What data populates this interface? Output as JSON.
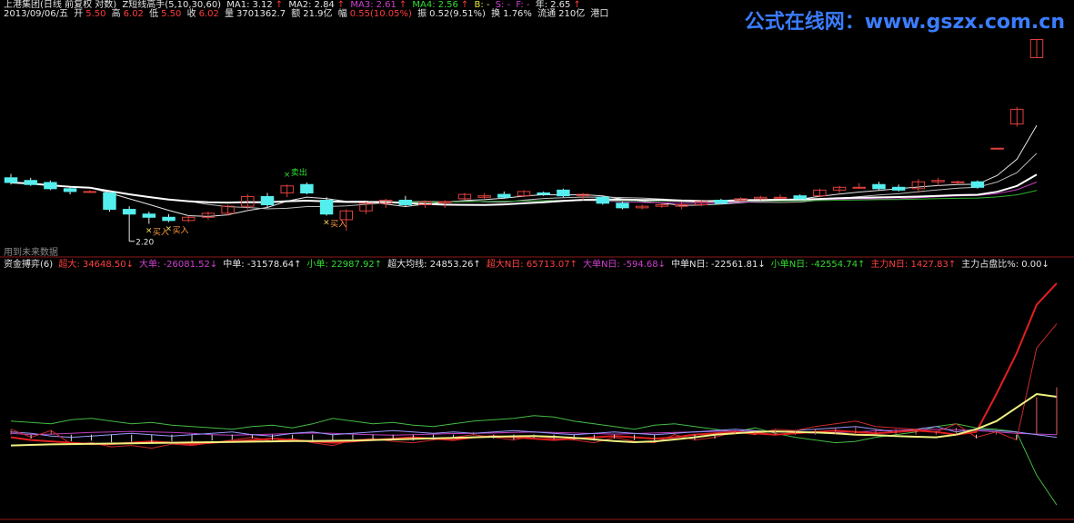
{
  "header": {
    "title": "上港集团(日线 前复权 对数)",
    "indicator": "Z短线高手(5,10,30,60)",
    "ma1_label": "MA1:",
    "ma1": "3.12",
    "ma2_label": "MA2:",
    "ma2": "2.84",
    "ma3_label": "MA3:",
    "ma3": "2.61",
    "ma4_label": "MA4:",
    "ma4": "2.56",
    "b_label": "B: -",
    "s_label": "S: -",
    "f_label": "F: -",
    "year_label": "年:",
    "year_val": "2.65"
  },
  "quote": {
    "date": "2013/09/06/五",
    "open_label": "开",
    "open": "5.50",
    "high_label": "高",
    "high": "6.02",
    "low_label": "低",
    "low": "5.50",
    "close_label": "收",
    "close": "6.02",
    "vol_label": "量",
    "vol": "3701362.7",
    "amt_label": "额",
    "amt": "21.9亿",
    "chg_label": "幅",
    "chg": "0.55(10.05%)",
    "amp_label": "振",
    "amp": "0.52(9.51%)",
    "turn_label": "换",
    "turn": "1.76%",
    "float_label": "流通",
    "float": "210亿",
    "sector": "港口"
  },
  "watermark": "公式在线网：www.gszx.com.cn",
  "future_note": "用到未来数据",
  "lower_panel": {
    "name": "资金搏弈(6)",
    "items": [
      {
        "label": "超大:",
        "value": "34648.50",
        "arrow": "↓",
        "color": "#ff4040"
      },
      {
        "label": "大单:",
        "value": "-26081.52",
        "arrow": "↓",
        "color": "#d040d0"
      },
      {
        "label": "中单:",
        "value": "-31578.64",
        "arrow": "↑",
        "color": "#e6e6e6"
      },
      {
        "label": "小单:",
        "value": "22987.92",
        "arrow": "↑",
        "color": "#33dd33"
      },
      {
        "label": "超大均线:",
        "value": "24853.26",
        "arrow": "↑",
        "color": "#e6e6e6"
      },
      {
        "label": "超大N日:",
        "value": "65713.07",
        "arrow": "↑",
        "color": "#ff4040"
      },
      {
        "label": "大单N日:",
        "value": "-594.68",
        "arrow": "↓",
        "color": "#d040d0"
      },
      {
        "label": "中单N日:",
        "value": "-22561.81",
        "arrow": "↓",
        "color": "#e6e6e6"
      },
      {
        "label": "小单N日:",
        "value": "-42554.74",
        "arrow": "↑",
        "color": "#33dd33"
      },
      {
        "label": "主力N日:",
        "value": "1427.83",
        "arrow": "↑",
        "color": "#ff4040"
      },
      {
        "label": "主力占盘比%:",
        "value": "0.00",
        "arrow": "↓",
        "color": "#e6e6e6"
      }
    ]
  },
  "chart_data": {
    "type": "candlestick",
    "candles": [
      {
        "o": 3.02,
        "h": 3.08,
        "l": 2.92,
        "c": 2.95
      },
      {
        "o": 2.98,
        "h": 3.02,
        "l": 2.9,
        "c": 2.92
      },
      {
        "o": 2.95,
        "h": 2.98,
        "l": 2.84,
        "c": 2.86
      },
      {
        "o": 2.86,
        "h": 2.9,
        "l": 2.78,
        "c": 2.82
      },
      {
        "o": 2.82,
        "h": 2.84,
        "l": 2.8,
        "c": 2.82
      },
      {
        "o": 2.8,
        "h": 2.82,
        "l": 2.55,
        "c": 2.58
      },
      {
        "o": 2.58,
        "h": 2.62,
        "l": 2.2,
        "c": 2.52
      },
      {
        "o": 2.52,
        "h": 2.55,
        "l": 2.4,
        "c": 2.48
      },
      {
        "o": 2.48,
        "h": 2.52,
        "l": 2.42,
        "c": 2.44
      },
      {
        "o": 2.44,
        "h": 2.5,
        "l": 2.42,
        "c": 2.48
      },
      {
        "o": 2.48,
        "h": 2.55,
        "l": 2.45,
        "c": 2.53
      },
      {
        "o": 2.53,
        "h": 2.64,
        "l": 2.5,
        "c": 2.62
      },
      {
        "o": 2.62,
        "h": 2.78,
        "l": 2.58,
        "c": 2.75
      },
      {
        "o": 2.75,
        "h": 2.8,
        "l": 2.6,
        "c": 2.64
      },
      {
        "o": 2.8,
        "h": 2.92,
        "l": 2.74,
        "c": 2.9
      },
      {
        "o": 2.92,
        "h": 2.95,
        "l": 2.78,
        "c": 2.8
      },
      {
        "o": 2.7,
        "h": 2.74,
        "l": 2.5,
        "c": 2.52
      },
      {
        "o": 2.45,
        "h": 2.58,
        "l": 2.32,
        "c": 2.56
      },
      {
        "o": 2.56,
        "h": 2.68,
        "l": 2.52,
        "c": 2.66
      },
      {
        "o": 2.66,
        "h": 2.72,
        "l": 2.6,
        "c": 2.7
      },
      {
        "o": 2.7,
        "h": 2.76,
        "l": 2.62,
        "c": 2.64
      },
      {
        "o": 2.64,
        "h": 2.7,
        "l": 2.6,
        "c": 2.68
      },
      {
        "o": 2.68,
        "h": 2.7,
        "l": 2.6,
        "c": 2.68
      },
      {
        "o": 2.72,
        "h": 2.8,
        "l": 2.7,
        "c": 2.78
      },
      {
        "o": 2.74,
        "h": 2.8,
        "l": 2.72,
        "c": 2.76
      },
      {
        "o": 2.78,
        "h": 2.82,
        "l": 2.72,
        "c": 2.74
      },
      {
        "o": 2.76,
        "h": 2.84,
        "l": 2.74,
        "c": 2.82
      },
      {
        "o": 2.8,
        "h": 2.82,
        "l": 2.76,
        "c": 2.78
      },
      {
        "o": 2.84,
        "h": 2.86,
        "l": 2.74,
        "c": 2.76
      },
      {
        "o": 2.76,
        "h": 2.8,
        "l": 2.7,
        "c": 2.78
      },
      {
        "o": 2.74,
        "h": 2.76,
        "l": 2.64,
        "c": 2.66
      },
      {
        "o": 2.66,
        "h": 2.68,
        "l": 2.58,
        "c": 2.6
      },
      {
        "o": 2.6,
        "h": 2.64,
        "l": 2.58,
        "c": 2.62
      },
      {
        "o": 2.62,
        "h": 2.66,
        "l": 2.6,
        "c": 2.64
      },
      {
        "o": 2.62,
        "h": 2.68,
        "l": 2.58,
        "c": 2.64
      },
      {
        "o": 2.64,
        "h": 2.7,
        "l": 2.62,
        "c": 2.68
      },
      {
        "o": 2.7,
        "h": 2.72,
        "l": 2.66,
        "c": 2.66
      },
      {
        "o": 2.7,
        "h": 2.74,
        "l": 2.68,
        "c": 2.72
      },
      {
        "o": 2.72,
        "h": 2.76,
        "l": 2.7,
        "c": 2.74
      },
      {
        "o": 2.74,
        "h": 2.78,
        "l": 2.72,
        "c": 2.74
      },
      {
        "o": 2.76,
        "h": 2.78,
        "l": 2.7,
        "c": 2.72
      },
      {
        "o": 2.76,
        "h": 2.86,
        "l": 2.74,
        "c": 2.84
      },
      {
        "o": 2.84,
        "h": 2.9,
        "l": 2.8,
        "c": 2.88
      },
      {
        "o": 2.88,
        "h": 2.94,
        "l": 2.86,
        "c": 2.88
      },
      {
        "o": 2.92,
        "h": 2.96,
        "l": 2.84,
        "c": 2.86
      },
      {
        "o": 2.88,
        "h": 2.92,
        "l": 2.82,
        "c": 2.84
      },
      {
        "o": 2.86,
        "h": 3.0,
        "l": 2.8,
        "c": 2.96
      },
      {
        "o": 2.96,
        "h": 3.02,
        "l": 2.9,
        "c": 2.98
      },
      {
        "o": 2.96,
        "h": 2.98,
        "l": 2.92,
        "c": 2.96
      },
      {
        "o": 2.96,
        "h": 2.98,
        "l": 2.86,
        "c": 2.88
      },
      {
        "o": 3.5,
        "h": 3.5,
        "l": 3.5,
        "c": 3.5
      },
      {
        "o": 3.95,
        "h": 4.3,
        "l": 3.9,
        "c": 4.25
      },
      {
        "o": 5.5,
        "h": 6.02,
        "l": 5.5,
        "c": 6.02
      }
    ],
    "low_marker": "2.20",
    "signals": [
      {
        "text": "卖出",
        "index": 14,
        "color": "#33dd33"
      },
      {
        "text": "买入",
        "index": 7,
        "color": "#ff9a3c"
      },
      {
        "text": "买入",
        "index": 8,
        "color": "#ff9a3c"
      },
      {
        "text": "买入",
        "index": 16,
        "color": "#ff9a3c"
      }
    ],
    "flows": {
      "super": [
        0.2,
        -0.1,
        0.15,
        -0.35,
        -0.3,
        -0.45,
        -0.4,
        -0.5,
        -0.35,
        -0.4,
        -0.3,
        -0.2,
        -0.1,
        -0.25,
        -0.15,
        -0.3,
        -0.4,
        -0.2,
        -0.15,
        -0.25,
        -0.3,
        -0.2,
        -0.1,
        0.0,
        -0.1,
        -0.2,
        -0.05,
        -0.15,
        -0.2,
        -0.3,
        -0.1,
        -0.25,
        -0.3,
        0.0,
        -0.2,
        -0.1,
        0.1,
        0.0,
        0.2,
        0.15,
        0.3,
        0.4,
        0.5,
        0.3,
        0.25,
        0.2,
        0.1,
        0.4,
        -0.1,
        0.1,
        -0.2,
        3.2,
        4.1
      ],
      "big": [
        0.1,
        0.05,
        -0.05,
        -0.1,
        -0.05,
        0.0,
        0.05,
        0.0,
        -0.05,
        0.0,
        0.05,
        0.1,
        0.0,
        -0.05,
        0.05,
        0.1,
        0.0,
        0.05,
        0.1,
        0.15,
        0.1,
        0.05,
        0.1,
        0.05,
        0.1,
        0.15,
        0.1,
        0.05,
        0.0,
        0.05,
        0.1,
        0.05,
        0.0,
        0.05,
        0.1,
        0.15,
        0.2,
        0.15,
        0.1,
        0.15,
        0.2,
        0.25,
        0.3,
        0.2,
        0.1,
        0.2,
        0.3,
        0.1,
        0.2,
        0.15,
        0.1,
        0.0,
        -0.1
      ],
      "small": [
        0.5,
        0.45,
        0.4,
        0.55,
        0.6,
        0.5,
        0.4,
        0.45,
        0.35,
        0.3,
        0.25,
        0.2,
        0.3,
        0.35,
        0.25,
        0.4,
        0.6,
        0.5,
        0.4,
        0.45,
        0.35,
        0.3,
        0.4,
        0.5,
        0.55,
        0.6,
        0.7,
        0.65,
        0.5,
        0.4,
        0.3,
        0.2,
        0.35,
        0.4,
        0.3,
        0.2,
        0.1,
        0.25,
        0.05,
        -0.1,
        -0.2,
        -0.3,
        -0.25,
        -0.1,
        0.0,
        0.1,
        0.3,
        0.4,
        0.25,
        0.2,
        0.1,
        -1.5,
        -2.6
      ],
      "super_ma": [
        -0.4,
        -0.38,
        -0.36,
        -0.35,
        -0.34,
        -0.33,
        -0.32,
        -0.31,
        -0.3,
        -0.29,
        -0.28,
        -0.27,
        -0.26,
        -0.25,
        -0.24,
        -0.24,
        -0.23,
        -0.22,
        -0.2,
        -0.18,
        -0.16,
        -0.14,
        -0.12,
        -0.1,
        -0.08,
        -0.06,
        -0.05,
        -0.08,
        -0.12,
        -0.18,
        -0.24,
        -0.28,
        -0.25,
        -0.18,
        -0.1,
        0.0,
        0.05,
        0.1,
        0.12,
        0.1,
        0.08,
        0.05,
        0.0,
        -0.02,
        -0.05,
        -0.08,
        -0.1,
        0.0,
        0.2,
        0.5,
        1.0,
        1.5,
        1.4
      ],
      "super_n": [
        -0.1,
        -0.2,
        -0.25,
        -0.3,
        -0.35,
        -0.35,
        -0.3,
        -0.25,
        -0.3,
        -0.35,
        -0.3,
        -0.25,
        -0.2,
        -0.15,
        -0.2,
        -0.25,
        -0.3,
        -0.25,
        -0.2,
        -0.15,
        -0.1,
        -0.15,
        -0.2,
        -0.1,
        -0.05,
        -0.1,
        -0.15,
        -0.2,
        -0.15,
        -0.1,
        -0.05,
        -0.1,
        -0.15,
        -0.1,
        0.0,
        0.05,
        0.1,
        0.05,
        0.0,
        0.05,
        0.1,
        0.15,
        0.1,
        0.05,
        0.1,
        0.15,
        0.1,
        0.0,
        0.1,
        1.5,
        3.0,
        4.8,
        5.6
      ],
      "big_n": [
        0.05,
        0.0,
        0.02,
        0.05,
        0.08,
        0.1,
        0.12,
        0.1,
        0.08,
        0.05,
        0.0,
        -0.02,
        0.0,
        0.02,
        0.04,
        0.06,
        0.05,
        0.02,
        0.0,
        -0.02,
        0.0,
        0.02,
        0.04,
        0.05,
        0.06,
        0.08,
        0.1,
        0.08,
        0.06,
        0.04,
        0.02,
        0.04,
        0.06,
        0.08,
        0.1,
        0.12,
        0.14,
        0.12,
        0.1,
        0.08,
        0.06,
        0.08,
        0.1,
        0.14,
        0.16,
        0.18,
        0.2,
        0.18,
        0.15,
        0.1,
        0.05,
        0.02,
        0.0
      ]
    }
  }
}
